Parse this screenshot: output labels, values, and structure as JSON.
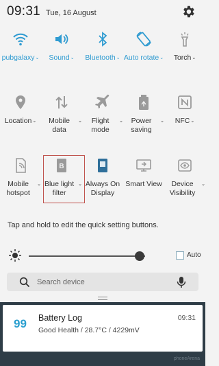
{
  "status_bar": {
    "time": "09:31",
    "date": "Tue, 16 August",
    "settings_icon": "gear-icon"
  },
  "quick_settings": {
    "row1": [
      {
        "id": "wifi",
        "icon": "wifi-icon",
        "label": "pubgalaxy",
        "active": true,
        "dropdown": true
      },
      {
        "id": "sound",
        "icon": "speaker-icon",
        "label": "Sound",
        "active": true,
        "dropdown": true
      },
      {
        "id": "bluetooth",
        "icon": "bluetooth-icon",
        "label": "Bluetooth",
        "active": true,
        "dropdown": true
      },
      {
        "id": "autorotate",
        "icon": "rotate-icon",
        "label": "Auto rotate",
        "active": true,
        "dropdown": true
      },
      {
        "id": "torch",
        "icon": "torch-icon",
        "label": "Torch",
        "active": false,
        "dropdown": true
      }
    ],
    "row2": [
      {
        "id": "location",
        "icon": "location-icon",
        "label": "Location",
        "active": false,
        "dropdown": true
      },
      {
        "id": "mobiledata",
        "icon": "mobile-data-icon",
        "label": "Mobile data",
        "active": false,
        "dropdown": true
      },
      {
        "id": "flightmode",
        "icon": "airplane-icon",
        "label": "Flight mode",
        "active": false,
        "dropdown": true
      },
      {
        "id": "powersaving",
        "icon": "battery-recycle-icon",
        "label": "Power saving",
        "active": false,
        "dropdown": true
      },
      {
        "id": "nfc",
        "icon": "nfc-icon",
        "label": "NFC",
        "active": false,
        "dropdown": true
      }
    ],
    "row3": [
      {
        "id": "hotspot",
        "icon": "hotspot-icon",
        "label": "Mobile hotspot",
        "active": false,
        "dropdown": true
      },
      {
        "id": "bluelight",
        "icon": "blue-light-filter-icon",
        "label": "Blue light filter",
        "active": false,
        "dropdown": true
      },
      {
        "id": "alwayson",
        "icon": "always-on-display-icon",
        "label": "Always On Display",
        "active": false,
        "dropdown": false
      },
      {
        "id": "smartview",
        "icon": "smart-view-icon",
        "label": "Smart View",
        "active": false,
        "dropdown": false
      },
      {
        "id": "devicevisibility",
        "icon": "eye-icon",
        "label": "Device Visibility",
        "active": false,
        "dropdown": true
      }
    ],
    "hint": "Tap and hold to edit the quick setting buttons."
  },
  "brightness": {
    "level": 0.95,
    "auto_label": "Auto",
    "auto_checked": false
  },
  "search": {
    "placeholder": "Search device"
  },
  "notification": {
    "badge": "99",
    "title": "Battery Log",
    "subtitle": "Good Health / 28.7°C / 4229mV",
    "time": "09:31"
  },
  "watermark": "phoneArena",
  "colors": {
    "accent": "#2f9bd1",
    "inactive_icon": "#9a9a9a",
    "highlight_box": "#c0544e",
    "notification_bg": "#2f3d47"
  }
}
